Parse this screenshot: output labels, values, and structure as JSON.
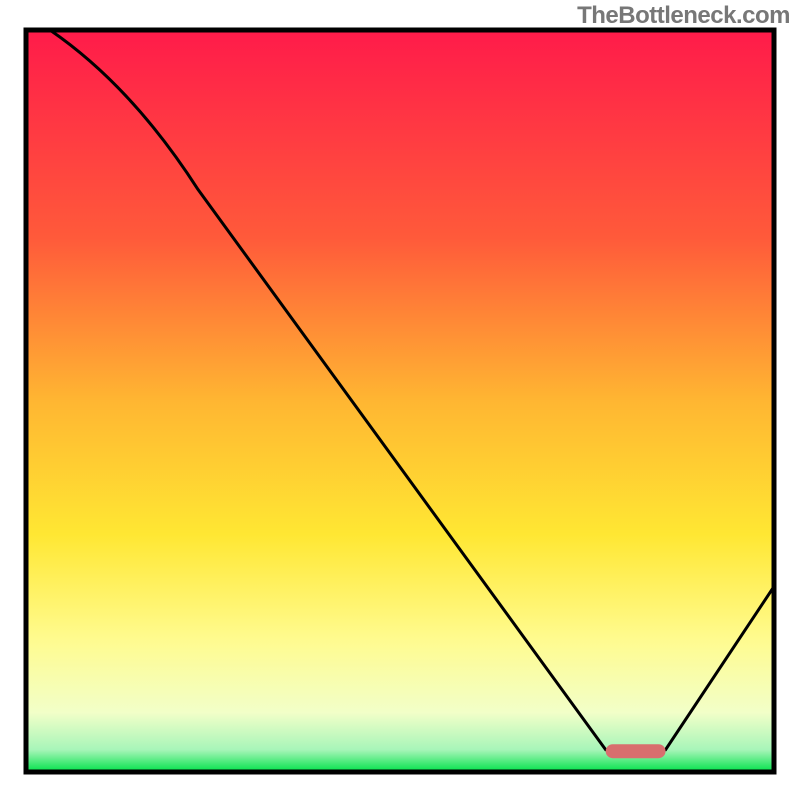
{
  "watermark": "TheBottleneck.com",
  "chart_data": {
    "type": "line",
    "title": "",
    "xlabel": "",
    "ylabel": "",
    "xlim": [
      0,
      100
    ],
    "ylim": [
      0,
      100
    ],
    "grid": false,
    "legend": false,
    "curve_points": [
      {
        "x": 3.2,
        "y": 100.0
      },
      {
        "x": 23.0,
        "y": 78.5
      },
      {
        "x": 77.5,
        "y": 3.0
      },
      {
        "x": 85.5,
        "y": 3.0
      },
      {
        "x": 100.0,
        "y": 25.0
      }
    ],
    "marker": {
      "shape": "rounded-bar",
      "x_start": 77.5,
      "x_end": 85.5,
      "y": 2.8,
      "color": "#d86e6e"
    },
    "gradient_stops": [
      {
        "pos": 0.0,
        "color": "#ff1b4a"
      },
      {
        "pos": 0.28,
        "color": "#ff5a3a"
      },
      {
        "pos": 0.5,
        "color": "#ffb632"
      },
      {
        "pos": 0.68,
        "color": "#ffe733"
      },
      {
        "pos": 0.82,
        "color": "#fffb8e"
      },
      {
        "pos": 0.92,
        "color": "#f2ffc8"
      },
      {
        "pos": 0.97,
        "color": "#a8f5b9"
      },
      {
        "pos": 1.0,
        "color": "#00e24a"
      }
    ],
    "border_color": "#000000",
    "curve_color": "#000000"
  }
}
